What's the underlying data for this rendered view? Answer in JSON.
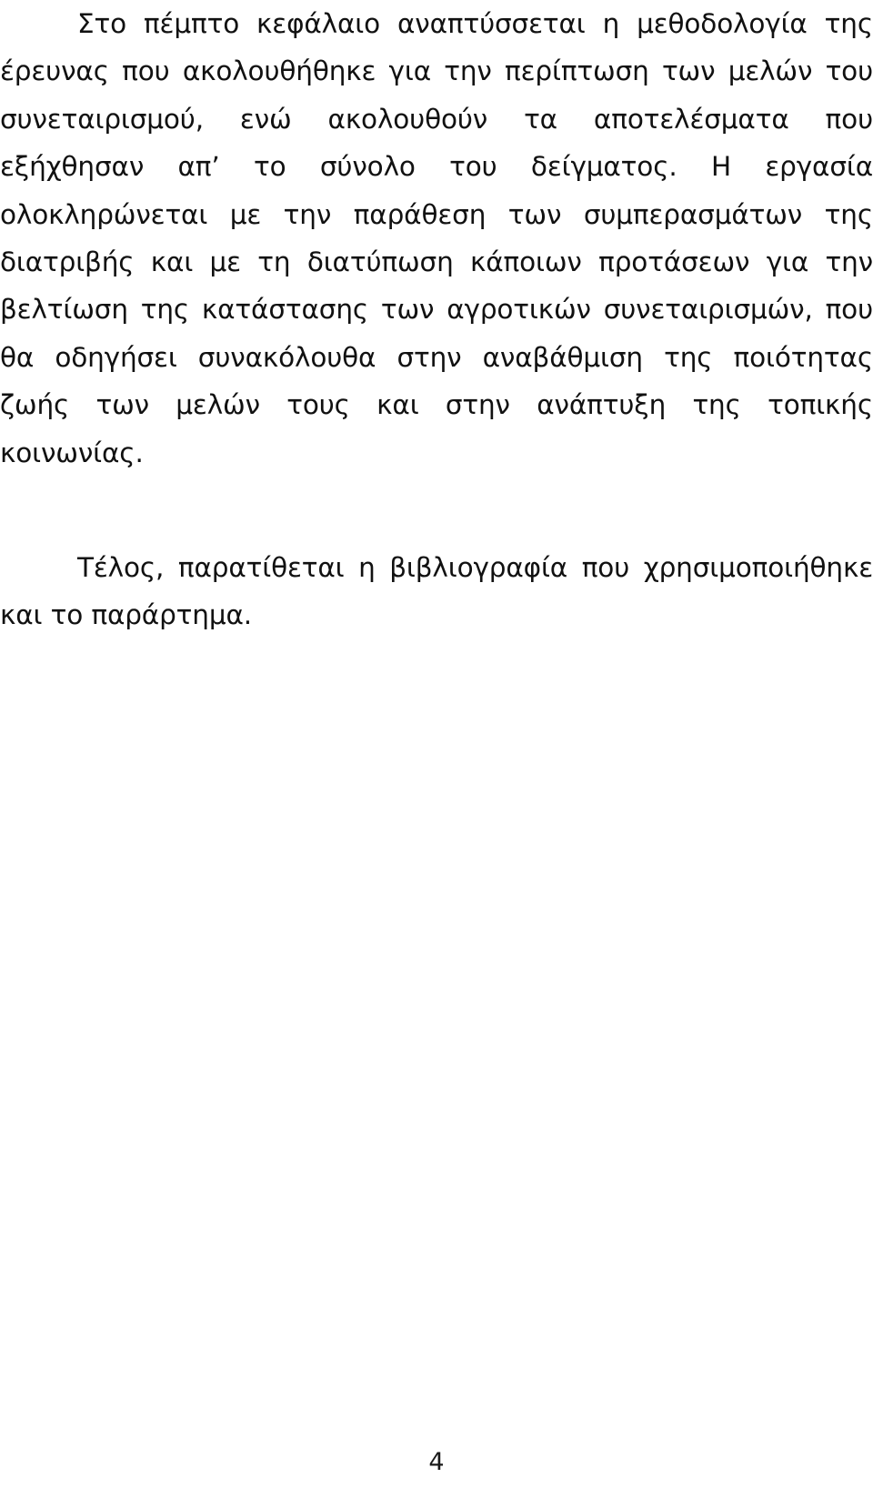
{
  "document": {
    "language": "el",
    "page_number": "4",
    "text_color": "#111111",
    "background_color": "#ffffff",
    "paragraphs": [
      {
        "id": "methodology-summary",
        "indented": true,
        "text": "Στο πέμπτο κεφάλαιο αναπτύσσεται η μεθοδολογία της έρευνας που ακολουθήθηκε για την περίπτωση των μελών του συνεταιρισμού, ενώ ακολουθούν τα αποτελέσματα που εξήχθησαν απ’ το σύνολο του δείγματος. Η εργασία ολοκληρώνεται με την παράθεση των συμπερασμάτων της διατριβής και με τη διατύπωση κάποιων προτάσεων για την βελτίωση της κατάστασης των αγροτικών συνεταιρισμών, που θα οδηγήσει συνακόλουθα στην αναβάθμιση της ποιότητας ζωής των μελών τους και στην ανάπτυξη της τοπικής κοινωνίας.",
        "lines": [
          "Στο πέμπτο κεφάλαιο αναπτύσσεται η μεθοδολογία της έρευνας που",
          "ακολουθήθηκε για την περίπτωση των μελών του συνεταιρισμού, ενώ ακολουθούν",
          "τα αποτελέσματα που εξήχθησαν απ’ το σύνολο του δείγματος. Η εργασία",
          "ολοκληρώνεται με την παράθεση των συμπερασμάτων της διατριβής και με τη",
          "διατύπωση κάποιων προτάσεων για την βελτίωση της κατάστασης των αγροτικών",
          "συνεταιρισμών, που θα οδηγήσει συνακόλουθα στην αναβάθμιση της ποιότητας",
          "ζωής των μελών τους και στην ανάπτυξη της τοπικής κοινωνίας."
        ]
      },
      {
        "id": "closing-bibliography",
        "indented": true,
        "text": "Τέλος, παρατίθεται η βιβλιογραφία που χρησιμοποιήθηκε και το παράρτημα.",
        "lines": [
          "Τέλος, παρατίθεται η βιβλιογραφία που χρησιμοποιήθηκε και το",
          "παράρτημα."
        ]
      }
    ]
  }
}
